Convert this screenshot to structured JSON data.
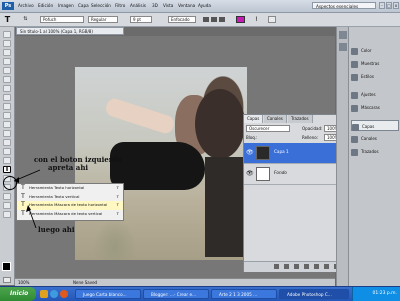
{
  "menubar": {
    "app_badge": "Ps",
    "items": [
      "Archivo",
      "Edición",
      "Imagen",
      "Capa",
      "Selección",
      "Filtro",
      "Análisis",
      "3D",
      "Vista",
      "Ventana",
      "Ayuda"
    ],
    "workspace": "Aspectos esenciales",
    "window_controls": [
      "-",
      "□",
      "x"
    ]
  },
  "options": {
    "font": "Pofuch",
    "style": "Regular",
    "size": "9 pt",
    "antialias": "Enfocado"
  },
  "document": {
    "tab_title": "Sin título-1 al 100% (Capa 1, RGB/8)",
    "status_zoom": "100%",
    "status_text": "Nene Saved"
  },
  "annotations": {
    "top_note_line1": "con el boton izquierdo",
    "top_note_line2": "apreta ahi",
    "bottom_note": "luego ahi",
    "step_label": "T"
  },
  "flyout": {
    "items": [
      {
        "label": "Herramienta Texto horizontal",
        "key": "T",
        "icon": "T"
      },
      {
        "label": "Herramienta Texto vertical",
        "key": "T",
        "icon": "T"
      },
      {
        "label": "Herramienta Máscara de texto horizontal",
        "key": "T",
        "icon": "T"
      },
      {
        "label": "Herramienta Máscara de texto vertical",
        "key": "T",
        "icon": "T"
      }
    ]
  },
  "layers": {
    "tabs": [
      "Capas",
      "Canales",
      "Trazados"
    ],
    "blend_mode": "Oscurecer",
    "opacity_label": "Opacidad:",
    "opacity": "100%",
    "lock_label": "Bloq.:",
    "fill_label": "Relleno:",
    "fill": "100%",
    "rows": [
      {
        "name": "Capa 1",
        "selected": true
      },
      {
        "name": "Fondo",
        "selected": false
      }
    ]
  },
  "dock": {
    "items": [
      "Color",
      "Muestras",
      "Estilos",
      "Ajustes",
      "Máscaras",
      "Capas",
      "Canales",
      "Trazados"
    ]
  },
  "taskbar": {
    "start": "Inicio",
    "tasks": [
      "Juego Carta blanco...",
      "Blogger: ...- Crear e...",
      "Arte 2 1 3 2005 ...",
      "Adobe Photoshop C..."
    ],
    "clock": "01:23 p.m."
  },
  "colors": {
    "accent": "#2456b6",
    "selected_layer": "#3a6fd8",
    "start_green": "#2e8b31"
  }
}
